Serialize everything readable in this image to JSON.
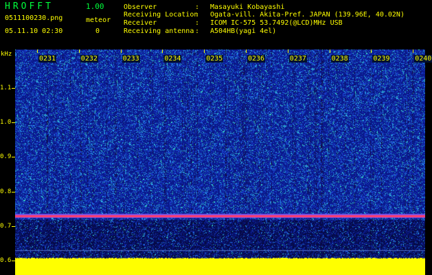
{
  "app": {
    "title": "HROFFT",
    "version": "1.00"
  },
  "file": {
    "name": "0511100230.png",
    "timestamp": "05.11.10 02:30"
  },
  "meteor": {
    "label": "meteor",
    "count": "0"
  },
  "info": [
    {
      "key": "Observer",
      "value": "Masayuki Kobayashi"
    },
    {
      "key": "Receiving Location",
      "value": "Ogata-vill. Akita-Pref. JAPAN (139.96E, 40.02N)"
    },
    {
      "key": "Receiver",
      "value": "ICOM IC-575 53.7492(@LCD)MHz USB"
    },
    {
      "key": "Receiving antenna",
      "value": "A504HB(yagi 4el)"
    }
  ],
  "separator": ":",
  "freq_axis": {
    "unit": "kHz",
    "ticks": [
      "1.1",
      "1.0",
      "0.9",
      "0.8",
      "0.7",
      "0.6"
    ],
    "carrier_khz": 0.73
  },
  "time_axis": {
    "ticks": [
      "0231",
      "0232",
      "0233",
      "0234",
      "0235",
      "0236",
      "0237",
      "0238",
      "0239",
      "0240"
    ]
  },
  "colors": {
    "label": "#ffff00",
    "title": "#00ff3c",
    "background": "#0a1a8a",
    "carrier": "#ff3a6a",
    "baseband": "#ffff00"
  }
}
